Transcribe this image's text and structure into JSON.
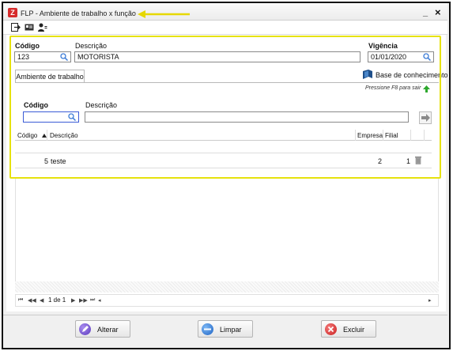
{
  "window": {
    "title": "FLP - Ambiente de trabalho x função",
    "minimize": "_",
    "close": "×"
  },
  "header": {
    "codigo_label": "Código",
    "codigo_value": "123",
    "descricao_label": "Descrição",
    "descricao_value": "MOTORISTA",
    "vigencia_label": "Vigência",
    "vigencia_value": "01/01/2020"
  },
  "tabs": [
    {
      "label": "Ambiente de trabalho"
    }
  ],
  "knowledge_base": {
    "label": "Base de conhecimento"
  },
  "hint": "Pressione F8 para sair",
  "filter": {
    "codigo_label": "Código",
    "descricao_label": "Descrição",
    "codigo_value": "",
    "descricao_value": ""
  },
  "grid": {
    "columns": [
      "Código",
      "Descrição",
      "Empresa",
      "Filial"
    ],
    "rows": [
      {
        "codigo": "5",
        "descricao": "teste",
        "empresa": "2",
        "filial": "1"
      }
    ]
  },
  "pager": {
    "first": "⏮",
    "prev_page": "◀◀",
    "prev": "◀",
    "page_text": "1 de 1",
    "next": "▶",
    "next_page": "▶▶",
    "last": "⏭"
  },
  "footer": {
    "alterar": "Alterar",
    "limpar": "Limpar",
    "excluir": "Excluir"
  },
  "colors": {
    "highlight": "#e6e20d",
    "accent": "#3b5bd6",
    "danger": "#e03030",
    "edit": "#6a4fc9",
    "clear": "#2d7bd6"
  },
  "icons": [
    "exit-icon",
    "card-icon",
    "user-icon",
    "search-icon",
    "book-icon",
    "arrow-right-icon",
    "trash-icon",
    "green-arrow-up-icon"
  ]
}
